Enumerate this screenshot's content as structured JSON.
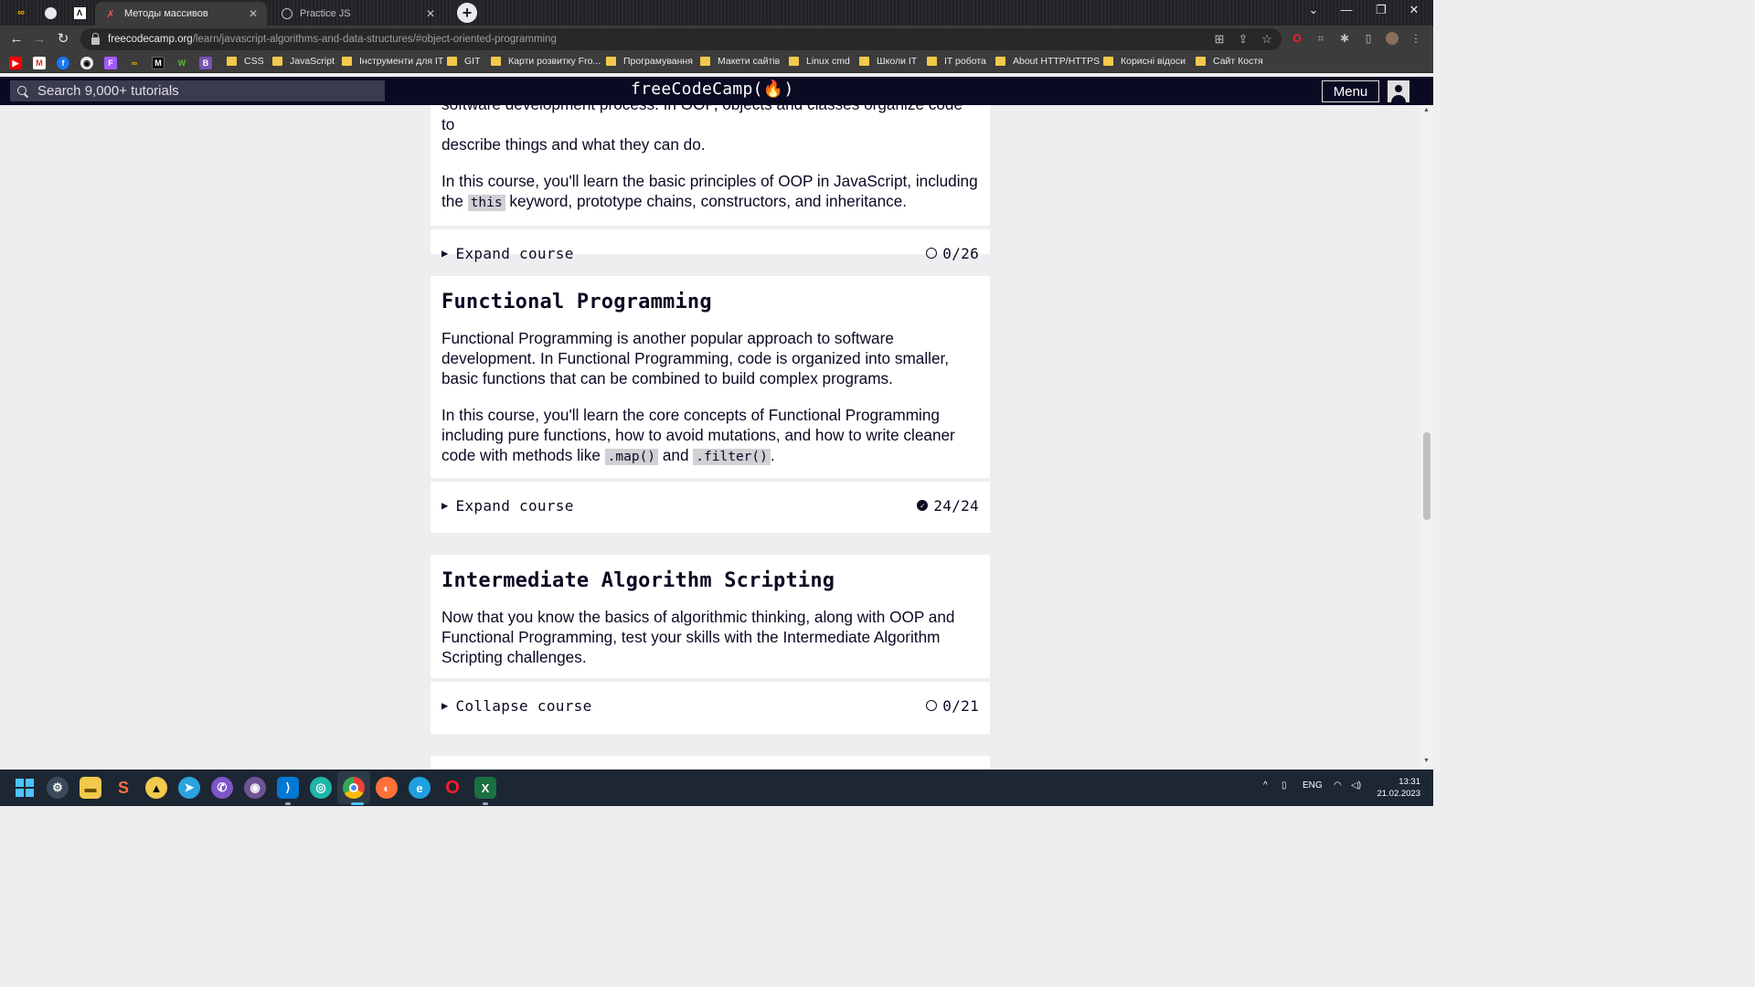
{
  "browser": {
    "tabs": [
      {
        "title": "Методы массивов",
        "active": true
      },
      {
        "title": "Practice JS",
        "active": false
      }
    ],
    "new_tab_symbol": "+",
    "url_host": "freecodecamp.org",
    "url_path": "/learn/javascript-algorithms-and-data-structures/#object-oriented-programming",
    "bookmarks": [
      "CSS",
      "JavaScript",
      "Інструменти для IT",
      "GIT",
      "Карти розвитку Fro...",
      "Програмування",
      "Макети сайтів",
      "Linux cmd",
      "Школи IT",
      "IT робота",
      "About HTTP/HTTPS",
      "Корисні відоси",
      "Сайт Костя"
    ]
  },
  "nav": {
    "search_placeholder": "Search 9,000+ tutorials",
    "logo": "freeCodeCamp(🔥)",
    "menu_label": "Menu"
  },
  "courses": {
    "oop": {
      "intro_partial": "software development process. In OOP, objects and classes organize code to",
      "intro_end": "describe things and what they can do.",
      "p2_start": "In this course, you'll learn the basic principles of OOP in JavaScript, including the",
      "p2_code": "this",
      "p2_end": "keyword, prototype chains, constructors, and inheritance.",
      "toggle": "Expand course",
      "progress": "0/26"
    },
    "functional": {
      "title": "Functional Programming",
      "p1": "Functional Programming is another popular approach to software development. In Functional Programming, code is organized into smaller, basic functions that can be combined to build complex programs.",
      "p2_start": "In this course, you'll learn the core concepts of Functional Programming including pure functions, how to avoid mutations, and how to write cleaner code with methods like",
      "code1": ".map()",
      "and": "and",
      "code2": ".filter()",
      "period": ".",
      "toggle": "Expand course",
      "progress": "24/24"
    },
    "intermediate": {
      "title": "Intermediate Algorithm Scripting",
      "p1": "Now that you know the basics of algorithmic thinking, along with OOP and Functional Programming, test your skills with the Intermediate Algorithm Scripting challenges.",
      "toggle": "Collapse course",
      "progress": "0/21"
    }
  },
  "taskbar": {
    "lang": "ENG",
    "time": "13:31",
    "date": "21.02.2023"
  }
}
